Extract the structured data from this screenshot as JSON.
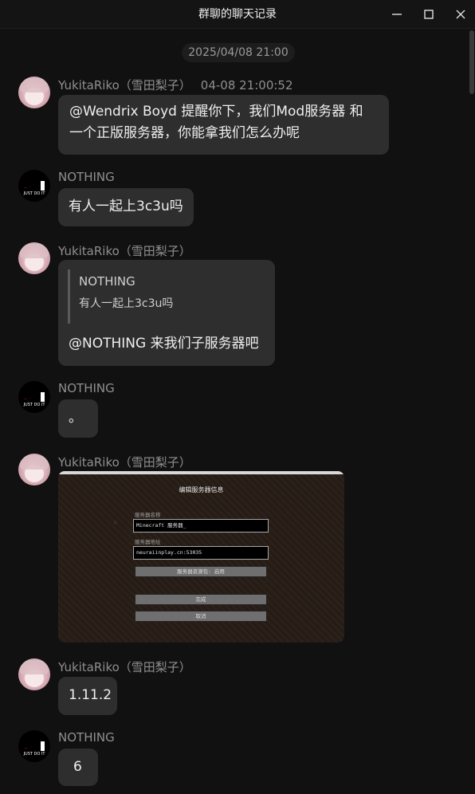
{
  "window": {
    "title": "群聊的聊天记录",
    "controls": [
      "minimize-icon",
      "maximize-icon",
      "close-icon"
    ]
  },
  "chat": {
    "date_separator": "2025/04/08 21:00",
    "messages": [
      {
        "sender": "YukitaRiko（雪田梨子）",
        "time": "04-08 21:00:52",
        "lines": [
          "@Wendrix Boyd 提醒你下，我们Mod服务器 和",
          "一个正版服务器，你能拿我们怎么办呢"
        ]
      },
      {
        "sender": "NOTHING",
        "lines": [
          "有人一起上3c3u吗"
        ]
      },
      {
        "sender": "YukitaRiko（雪田梨子）",
        "quote": {
          "name": "NOTHING",
          "text": "有人一起上3c3u吗"
        },
        "lines": [
          "@NOTHING 来我们子服务器吧"
        ]
      },
      {
        "sender": "NOTHING",
        "lines": [
          "。"
        ]
      },
      {
        "sender": "YukitaRiko（雪田梨子）",
        "image": {
          "title": "编辑服务器信息",
          "name_label": "服务器名称",
          "name_value": "Minecraft 服务器_",
          "address_label": "服务器地址",
          "address_value": "neuraiinplay.cn:53035",
          "resource_pack_button": "服务器资源包: 启用",
          "done_button": "完成",
          "cancel_button": "取消"
        }
      },
      {
        "sender": "YukitaRiko（雪田梨子）",
        "lines": [
          "1.11.2"
        ]
      },
      {
        "sender": "NOTHING",
        "lines": [
          "6"
        ]
      }
    ]
  },
  "avatar_nike_text": "JUST DO IT",
  "colors": {
    "background": "#111111",
    "bubble": "#2e2e2e",
    "sender_text": "#8f8f8f",
    "nike_swoosh": "#e02020"
  }
}
